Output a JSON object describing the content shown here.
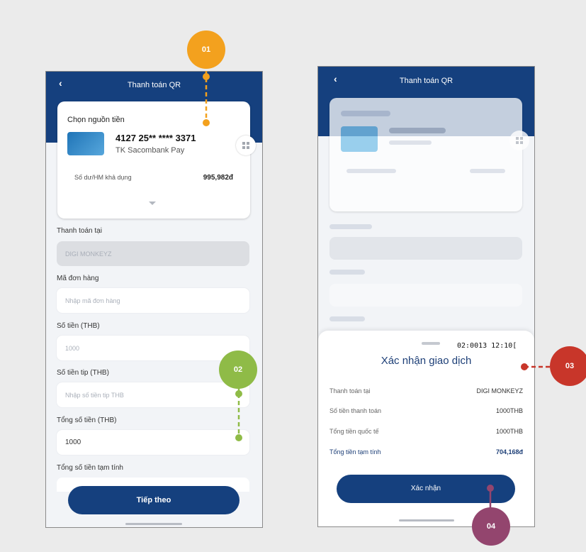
{
  "left_screen": {
    "header_title": "Thanh toán QR",
    "back_glyph": "‹",
    "source_card": {
      "title": "Chọn nguồn tiền",
      "card_number": "4127 25** **** 3371",
      "card_type": "TK Sacombank Pay",
      "balance_label": "Số dư/HM khả dụng",
      "balance_value": "995,982đ"
    },
    "pay_at_label": "Thanh toán tại",
    "pay_at_value": "DIGI MONKEYZ",
    "order_label": "Mã đơn hàng",
    "order_placeholder": "Nhập mã đơn hàng",
    "amount_label": "Số tiền (THB)",
    "amount_value": "1000",
    "tip_label": "Số tiền tip (THB)",
    "tip_placeholder": "Nhập số tiền tip THB",
    "total_label": "Tổng số tiền (THB)",
    "total_value": "1000",
    "estimated_label": "Tổng số tiền tạm tính",
    "next_button": "Tiếp theo"
  },
  "right_screen": {
    "header_title": "Thanh toán QR",
    "back_glyph": "‹",
    "sheet": {
      "timer": "02:0013 12:10[",
      "title": "Xác nhận giao dịch",
      "rows": [
        {
          "label": "Thanh toán tại",
          "value": "DIGI MONKEYZ"
        },
        {
          "label": "Số tiền thanh toán",
          "value": "1000THB"
        },
        {
          "label": "Tổng tiền quốc tế",
          "value": "1000THB"
        },
        {
          "label": "Tổng tiền tạm tính",
          "value": "704,168đ"
        }
      ],
      "confirm_button": "Xác nhận"
    }
  },
  "callouts": {
    "c01": "01",
    "c02": "02",
    "c03": "03",
    "c04": "04"
  },
  "colors": {
    "brand_blue": "#15407e",
    "callout_01": "#f3a11e",
    "callout_02": "#8fbb47",
    "callout_03": "#c8362a",
    "callout_04": "#93456e"
  },
  "icons": [
    "back-chevron-icon",
    "qr-grid-icon",
    "chevron-down-icon",
    "card-thumbnail-icon"
  ]
}
